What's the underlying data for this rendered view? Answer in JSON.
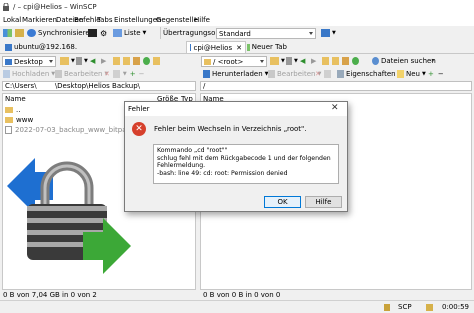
{
  "window": {
    "title": "/ – cpi@Helios – WinSCP"
  },
  "menu": [
    "Lokal",
    "Markieren",
    "Dateien",
    "Befehle",
    "Tabs",
    "Einstellungen",
    "Gegenstelle",
    "Hilfe"
  ],
  "toolbar1": {
    "sync_label": "Synchronisieren",
    "queue_label": "Liste",
    "transfer_options_label": "Übertragungsoptionen",
    "transfer_options_value": "Standard"
  },
  "tabs": {
    "ubuntu": "ubuntu@192.168.",
    "cpi": "cpi@Helios",
    "new_tab": "Neuer Tab"
  },
  "left_toolbar": {
    "drive": "Desktop",
    "upload": "Hochladen",
    "edit": "Bearbeiten"
  },
  "right_toolbar": {
    "dir": "/ <root>",
    "find_files": "Dateien suchen",
    "download": "Herunterladen",
    "edit": "Bearbeiten",
    "properties": "Eigenschaften",
    "new": "Neu"
  },
  "left_pane": {
    "path": "C:\\Users\\",
    "path2": "\\Desktop\\Helios Backup\\",
    "col_name": "Name",
    "col_size": "Größe",
    "col_type": "Typ",
    "rows": [
      "..",
      "www",
      "2022-07-03_backup_www_bitpage_senned"
    ],
    "status": "0 B von 7,04 GB in 0 von 2"
  },
  "right_pane": {
    "path": "/",
    "col_name": "Name",
    "status": "0 B von 0 B in 0 von 0"
  },
  "statusbar": {
    "protocol": "SCP",
    "time": "0:00:59"
  },
  "dialog": {
    "title": "Fehler",
    "message": "Fehler beim Wechseln in Verzeichnis „root\".",
    "details": [
      "Kommando „cd \"root\"\"",
      "schlug fehl mit dem Rückgabecode 1 und der folgenden",
      "Fehlermeldung.",
      "-bash: line 49: cd: root: Permission denied"
    ],
    "ok_label": "OK",
    "help_label": "Hilfe"
  },
  "colors": {
    "error_red": "#d6402c",
    "window_bg": "#f0f0f0",
    "button_focus": "#0078d7",
    "lock_blue": "#1e6fd1",
    "lock_green": "#3ca837"
  }
}
